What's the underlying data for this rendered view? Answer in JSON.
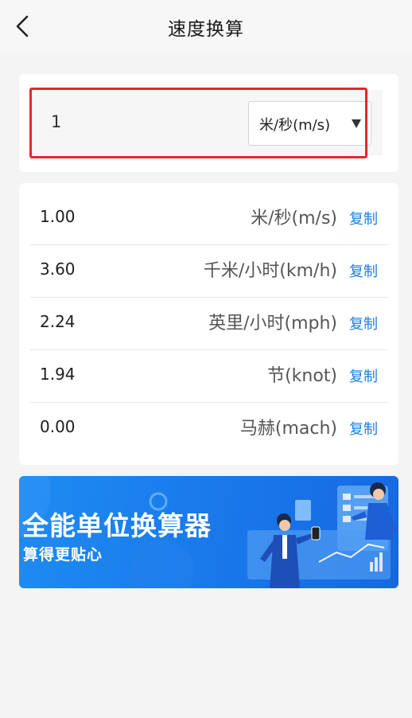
{
  "header": {
    "title": "速度换算"
  },
  "input": {
    "value": "1",
    "unit": "米/秒(m/s)"
  },
  "results": [
    {
      "value": "1.00",
      "unit": "米/秒(m/s)",
      "copy_label": "复制"
    },
    {
      "value": "3.60",
      "unit": "千米/小时(km/h)",
      "copy_label": "复制"
    },
    {
      "value": "2.24",
      "unit": "英里/小时(mph)",
      "copy_label": "复制"
    },
    {
      "value": "1.94",
      "unit": "节(knot)",
      "copy_label": "复制"
    },
    {
      "value": "0.00",
      "unit": "马赫(mach)",
      "copy_label": "复制"
    }
  ],
  "banner": {
    "title": "全能单位换算器",
    "subtitle": "算得更贴心"
  },
  "colors": {
    "accent": "#1c7fe0",
    "highlight": "#e8262b",
    "banner": "#1977ea"
  }
}
